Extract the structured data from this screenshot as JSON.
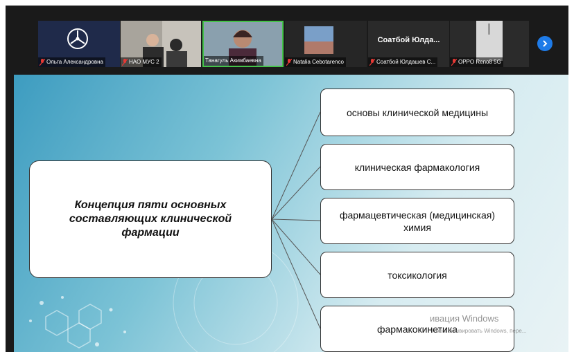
{
  "participants": [
    {
      "name": "Ольга Александровна",
      "muted": true
    },
    {
      "name": "НАО МУС 2",
      "muted": true
    },
    {
      "name": "Танагуль Акимбаевна",
      "muted": false,
      "active_speaker": true
    },
    {
      "name": "Natalia Cebotarenco",
      "muted": true
    },
    {
      "name": "Соатбой Юлдашев С...",
      "muted": true,
      "display_label": "Соатбой  Юлда..."
    },
    {
      "name": "OPPO Reno8 5G",
      "muted": true
    }
  ],
  "navigation": {
    "next_icon": "chevron-right-icon"
  },
  "slide": {
    "concept": "Концепция пяти основных составляющих клинической фармации",
    "components": [
      "основы клинической медицины",
      "клиническая фармакология",
      "фармацевтическая (медицинская) химия",
      "токсикология",
      "фармакокинетика"
    ]
  },
  "watermark": {
    "title": "ивация Windows",
    "subtitle": "Чтобы активировать Windows, пере..."
  },
  "colors": {
    "active_speaker_border": "#45c34a",
    "muted_icon": "#e53935",
    "next_button": "#1e7be8"
  }
}
